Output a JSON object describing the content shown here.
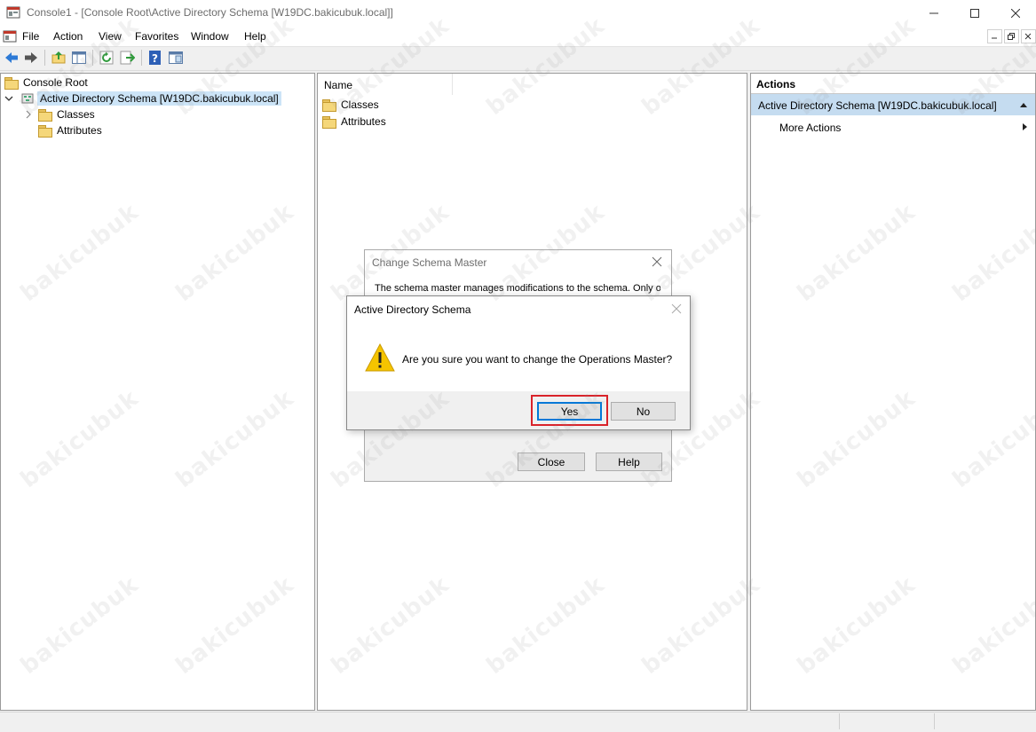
{
  "window": {
    "title": "Console1 - [Console Root\\Active Directory Schema [W19DC.bakicubuk.local]]",
    "controls": [
      "minimize",
      "maximize",
      "close"
    ]
  },
  "menu": {
    "items": [
      "File",
      "Action",
      "View",
      "Favorites",
      "Window",
      "Help"
    ]
  },
  "toolbar": {
    "icons": [
      "back-icon",
      "forward-icon",
      "up-folder-icon",
      "show-hide-tree-icon",
      "refresh-icon",
      "export-icon",
      "help-icon",
      "properties-pane-icon"
    ]
  },
  "tree": {
    "root": "Console Root",
    "schema_node": "Active Directory Schema [W19DC.bakicubuk.local]",
    "children": [
      "Classes",
      "Attributes"
    ]
  },
  "list": {
    "column_header": "Name",
    "items": [
      "Classes",
      "Attributes"
    ]
  },
  "actions": {
    "header": "Actions",
    "section": "Active Directory Schema [W19DC.bakicubuk.local]",
    "more": "More Actions"
  },
  "dialog_back": {
    "title": "Change Schema Master",
    "text": "The schema master manages modifications to the schema. Only one",
    "close_label": "Close",
    "help_label": "Help"
  },
  "dialog_front": {
    "title": "Active Directory Schema",
    "message": "Are you sure you want to change the Operations Master?",
    "yes_label": "Yes",
    "no_label": "No"
  },
  "watermark": "bakicubuk",
  "colors": {
    "selection_highlight": "#cce4f7",
    "actions_header_bg": "#c5dcf0",
    "yes_highlight_border": "#d9232a",
    "warning_yellow": "#f5c400"
  }
}
